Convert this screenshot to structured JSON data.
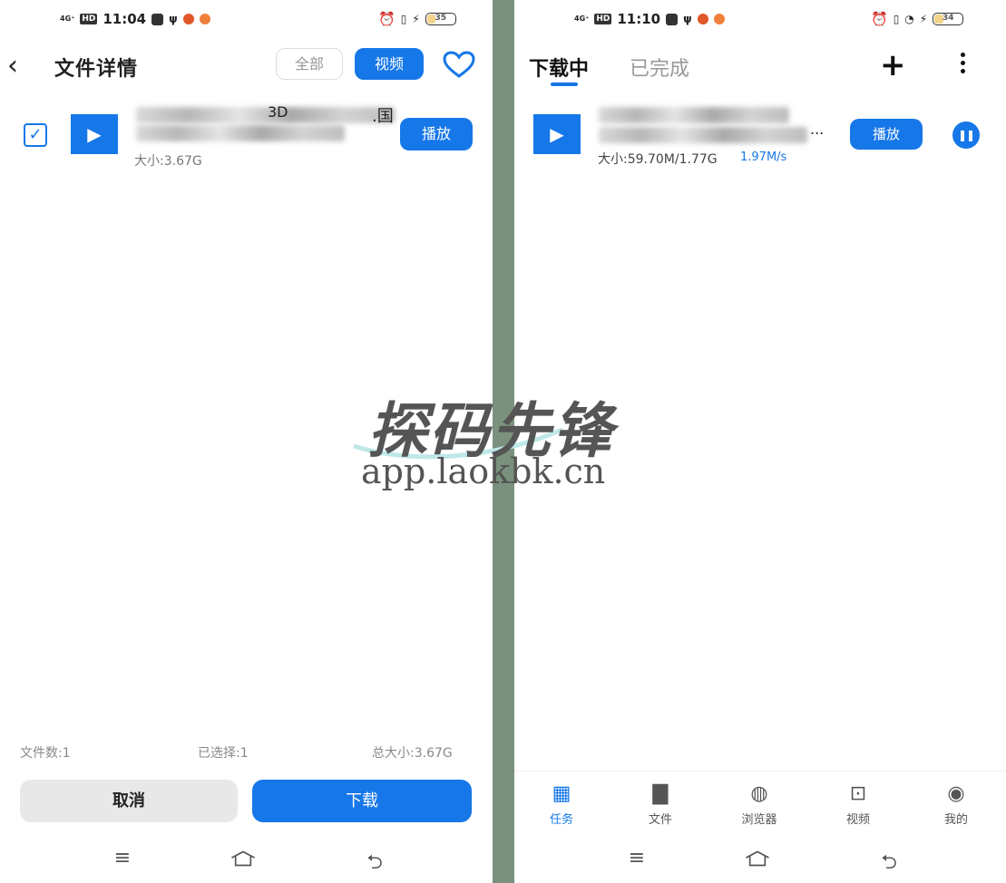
{
  "left": {
    "status": {
      "signal": "4G⁺",
      "time": "11:04",
      "battery": "35"
    },
    "header": {
      "title": "文件详情",
      "filter_all": "全部",
      "filter_video": "视频"
    },
    "file": {
      "name_visible_fragment": "3D",
      "name_tail": ".国",
      "size": "大小:3.67G",
      "play_label": "播放",
      "checked": true
    },
    "summary": {
      "file_count": "文件数:1",
      "selected": "已选择:1",
      "total_size": "总大小:3.67G"
    },
    "buttons": {
      "cancel": "取消",
      "download": "下载"
    }
  },
  "right": {
    "status": {
      "signal": "4G⁺",
      "time": "11:10",
      "battery": "34"
    },
    "tabs": {
      "downloading": "下载中",
      "completed": "已完成"
    },
    "task": {
      "name_tail": "...",
      "size": "大小:59.70M/1.77G",
      "speed": "1.97M/s",
      "play_label": "播放"
    },
    "tabbar": [
      {
        "label": "任务",
        "icon": "grid-icon",
        "active": true
      },
      {
        "label": "文件",
        "icon": "file-icon",
        "active": false
      },
      {
        "label": "浏览器",
        "icon": "globe-icon",
        "active": false
      },
      {
        "label": "视频",
        "icon": "video-icon",
        "active": false
      },
      {
        "label": "我的",
        "icon": "profile-icon",
        "active": false
      }
    ]
  },
  "watermark": {
    "title": "探码先锋",
    "url": "app.laokbk.cn"
  },
  "colors": {
    "accent": "#1677e8",
    "divider": "#7a917d"
  }
}
